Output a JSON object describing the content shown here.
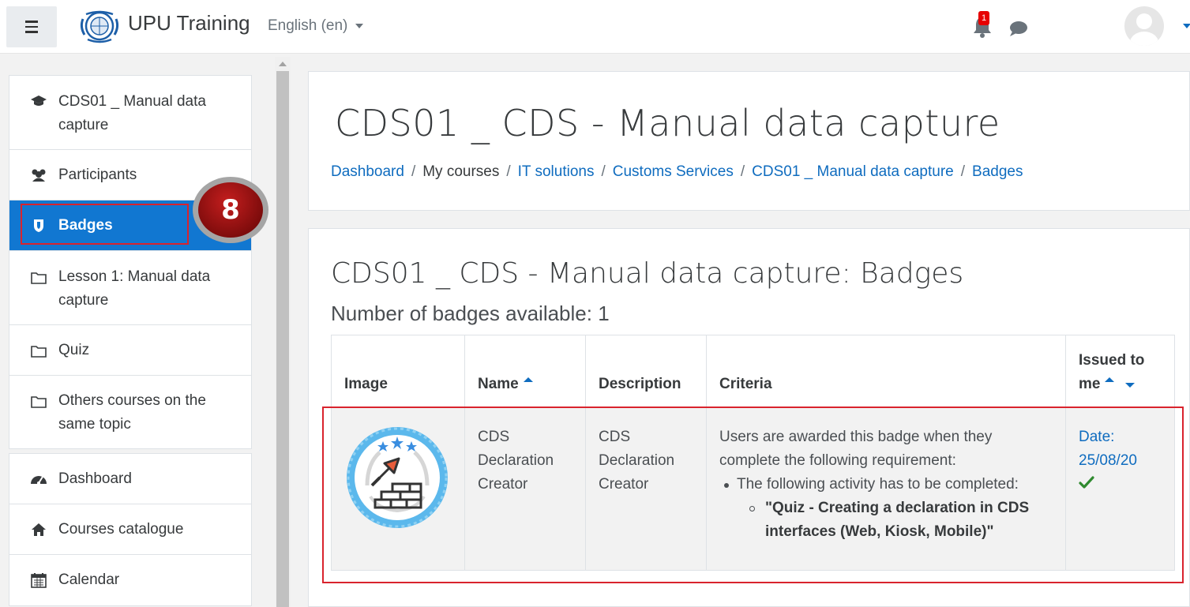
{
  "navbar": {
    "menu_icon": "hamburger-icon",
    "site_name": "UPU Training",
    "language": "English (en)",
    "notification_count": "1",
    "notification_icon": "bell-icon",
    "messages_icon": "chat-icon",
    "avatar_icon": "user-avatar-icon"
  },
  "drawer": {
    "course_group": [
      {
        "label": "CDS01 _ Manual data capture",
        "icon": "graduation-cap-icon"
      },
      {
        "label": "Participants",
        "icon": "users-icon"
      },
      {
        "label": "Badges",
        "icon": "shield-icon",
        "active": true
      },
      {
        "label": "Lesson 1: Manual data capture",
        "icon": "folder-icon"
      },
      {
        "label": "Quiz",
        "icon": "folder-icon"
      },
      {
        "label": "Others courses on the same topic",
        "icon": "folder-icon"
      }
    ],
    "site_group": [
      {
        "label": "Dashboard",
        "icon": "dashboard-icon"
      },
      {
        "label": "Courses catalogue",
        "icon": "home-icon"
      },
      {
        "label": "Calendar",
        "icon": "calendar-icon"
      }
    ],
    "step_marker": "8"
  },
  "header": {
    "title": "CDS01 _ CDS - Manual data capture",
    "breadcrumb": [
      {
        "label": "Dashboard",
        "link": true
      },
      {
        "label": "My courses",
        "link": false
      },
      {
        "label": "IT solutions",
        "link": true
      },
      {
        "label": "Customs Services",
        "link": true
      },
      {
        "label": "CDS01 _ Manual data capture",
        "link": true
      },
      {
        "label": "Badges",
        "link": true
      }
    ],
    "separator": "/"
  },
  "content": {
    "title": "CDS01 _ CDS - Manual data capture: Badges",
    "subtitle": "Number of badges available: 1",
    "table": {
      "headers": {
        "image": "Image",
        "name": "Name",
        "description": "Description",
        "criteria": "Criteria",
        "issued": "Issued to me"
      },
      "rows": [
        {
          "name": "CDS Declaration Creator",
          "description": "CDS Declaration Creator",
          "criteria_intro": "Users are awarded this badge when they complete the following requirement:",
          "criteria_item": "The following activity has to be completed:",
          "criteria_activity": "\"Quiz - Creating a declaration in CDS interfaces (Web, Kiosk, Mobile)\"",
          "issued_date": "Date: 25/08/20",
          "issued_icon": "checkmark-icon"
        }
      ]
    }
  },
  "colors": {
    "accent": "#0f6cbf",
    "active_nav": "#1177d1",
    "highlight": "#d9232d",
    "check": "#2f8a2f"
  }
}
